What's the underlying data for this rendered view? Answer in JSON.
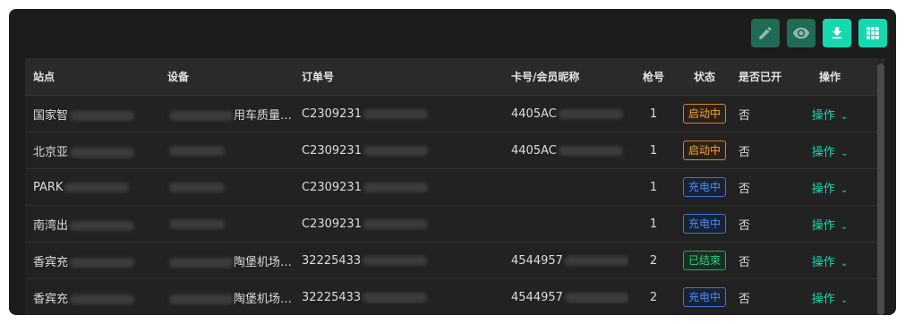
{
  "toolbar": {
    "edit_icon": "pencil-icon",
    "view_icon": "eye-icon",
    "download_icon": "download-icon",
    "grid_icon": "grid-icon"
  },
  "table": {
    "headers": [
      "站点",
      "设备",
      "订单号",
      "卡号/会员昵称",
      "枪号",
      "状态",
      "是否已开",
      "操作"
    ],
    "rows": [
      {
        "site": "国家智",
        "device_suffix": "用车质量…",
        "order": "C2309231",
        "card": "4405AC",
        "gun": "1",
        "status": "启动中",
        "status_type": "starting",
        "invoiced": "否",
        "action": "操作"
      },
      {
        "site": "北京亚",
        "device_suffix": "",
        "order": "C2309231",
        "card": "4405AC",
        "gun": "1",
        "status": "启动中",
        "status_type": "starting",
        "invoiced": "否",
        "action": "操作"
      },
      {
        "site": "PARK",
        "device_suffix": "",
        "order": "C2309231",
        "card": "",
        "gun": "1",
        "status": "充电中",
        "status_type": "charging",
        "invoiced": "否",
        "action": "操作"
      },
      {
        "site": "南湾出",
        "device_suffix": "",
        "order": "C2309231",
        "card": "",
        "gun": "1",
        "status": "充电中",
        "status_type": "charging",
        "invoiced": "否",
        "action": "操作"
      },
      {
        "site": "香宾充",
        "device_suffix": "陶堡机场…",
        "order": "32225433",
        "card": "4544957",
        "gun": "2",
        "status": "已结束",
        "status_type": "ended",
        "invoiced": "否",
        "action": "操作"
      },
      {
        "site": "香宾充",
        "device_suffix": "陶堡机场…",
        "order": "32225433",
        "card": "4544957",
        "gun": "2",
        "status": "充电中",
        "status_type": "charging",
        "invoiced": "否",
        "action": "操作"
      }
    ]
  },
  "colors": {
    "accent": "#14d9b0",
    "starting": "#f0a43a",
    "charging": "#4a8cf5",
    "ended": "#2fce86"
  }
}
